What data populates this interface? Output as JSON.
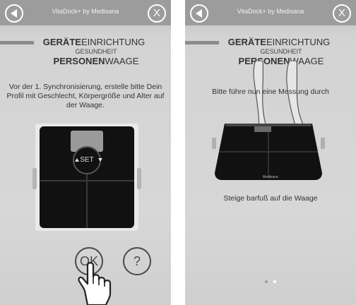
{
  "left": {
    "app_title": "VitaDock+ by Medisana",
    "heading_bold": "GERÄTE",
    "heading_rest": "EINRICHTUNG",
    "subheading": "GESUNDHEIT",
    "device_bold": "PERSONEN",
    "device_rest": "WAAGE",
    "instruction": "Vor der 1. Synchronisierung, erstelle bitte Dein Profil mit Geschlecht, Körpergröße und Alter auf der Waage.",
    "scale_set_label": "SET",
    "ok_label": "OK",
    "help_label": "?"
  },
  "right": {
    "app_title": "VitaDock+ by Medisana",
    "heading_bold": "GERÄTE",
    "heading_rest": "EINRICHTUNG",
    "subheading": "GESUNDHEIT",
    "device_bold": "PERSONEN",
    "device_rest": "WAAGE",
    "measure_text": "Bitte führe nun eine Messung durch",
    "step_text": "Steige barfuß auf die Waage",
    "scale_brand": "Medisana",
    "page_count": 2,
    "active_page": 2
  },
  "icons": {
    "back": "back-arrow-icon",
    "close": "close-x-icon",
    "hand": "tap-hand-icon",
    "feet": "feet-icon"
  }
}
